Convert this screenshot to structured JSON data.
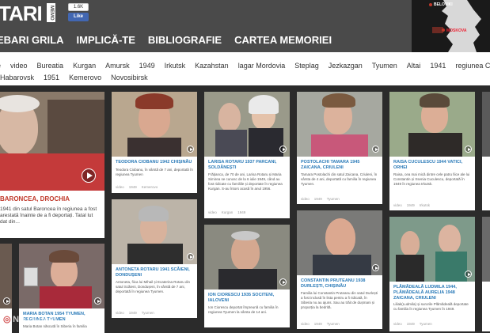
{
  "header": {
    "logo_text": "TARI",
    "logo_box": "MEMO",
    "fb_count": "1.6K",
    "fb_like": "Like",
    "nav": [
      "EBARI GRILA",
      "IMPLICĂ-TE",
      "BIBLIOGRAFIE",
      "CARTEA MEMORIEI"
    ]
  },
  "map": {
    "label_top": "BELOVIKI",
    "label_mid": "MOSKOVA"
  },
  "tags": {
    "row1": [
      "e",
      "video",
      "Bureatia",
      "Kurgan",
      "Amursk",
      "1949",
      "Irkutsk",
      "Kazahstan",
      "lagar Mordovia",
      "Steplag",
      "Jezkazgan",
      "Tyumen",
      "Altai",
      "1941",
      "regiunea Ci"
    ],
    "row2": [
      "Habarovsk",
      "1951",
      "Kemerovo",
      "Novosibirsk"
    ]
  },
  "cards": {
    "big": {
      "title": "BARONCEA, DROCHIA",
      "desc": "1941 din satul Baroncea în regiunea a fost arestată înainte de a fi deportați. Tatal lut dat din..."
    },
    "c1": {
      "title": "TEODORA CIOBANU 1942 CHIȘINĂU",
      "desc": "Teodora Ciobanu, în vârstă de 7 ani, deportată în regiunea Tyumen",
      "tags": [
        "video",
        "1949",
        "Kemerovo"
      ]
    },
    "c2": {
      "title": "LARISA ROTARU 1937 PARCANI, SOLDĂNEȘTI",
      "desc": "Frățianca, de 70 de ani, Larisa Rotaru și Maria Simirea se cunosc de la 6 iulie 1949, când au fost ridicate cu familiile și deportate în regiunea Kurgan. S-au întors acasă în anul 1956.",
      "tags": [
        "video",
        "Kurgan",
        "1949"
      ]
    },
    "c3": {
      "title": "POSTOLACHI TAMARA 1945 ZAICANA, CRIULENI",
      "desc": "Tamara Postolachi din satul Zaicana, Criuleni, în vârsta de 4 ani, deportată cu familia în regiunea Tyumen.",
      "tags": [
        "video",
        "1949",
        "Tyumen"
      ]
    },
    "c4": {
      "title": "RAISA CUCULESCU 1944 VATICI, ORHEI",
      "desc": "Raisa, cea mai mică dintre cele patru fiice ale lui Constantin și Xsenia Cuculescu, deportată în 1949 în regiunea Irkutsk.",
      "tags": [
        "video",
        "1949",
        "Irkutsk"
      ]
    },
    "c5": {
      "title": "ANTONETA ROTARU 1941 SCĂIENI, DONDUȘENI",
      "desc": "Antoneta, fiica lui Mihail și Ecaterina Rotaru din satul Scăieni, Dondușeni, în vârstă de 7 ani, deportată în regiunea Tyumen.",
      "tags": [
        "video",
        "1949",
        "Tyumen"
      ]
    },
    "c6": {
      "title": "ION CIORESCU 1935 SOCITENI, IALOVENI",
      "desc": "Ion Ciorescu deportat împreună cu familia în regiunea Tyumen la vârsta de 14 ani.",
      "tags": [
        "video",
        "1949",
        "Tyumen"
      ]
    },
    "c7": {
      "title": "CONSTANTIN PRUTEANU 1938 DURLEȘTI, CHIȘINĂU",
      "desc": "Familia lui Constantin Pruteanu din satul Durlești a fost inclusă în lista pentru a fi ridicată, în Siberia nu au ajuns. Sau au trăit de dușmani și proporția la bedrită.",
      "tags": [
        "video",
        "1949",
        "Tyumen"
      ]
    },
    "c8": {
      "title": "PLĂMĂDEALĂ LUDMILA 1944, PLĂMĂDEALĂ AURELIA 1948 ZAICANA, CRIULENI",
      "desc": "Liliak(Ludmila) și surorile Plămădeală deportate cu familia în regiunea Tyumen în 1949.",
      "tags": [
        "video",
        "1949",
        "Tyumen"
      ]
    },
    "c9": {
      "title": "MARIA BOTAN 1954 TYUMEN, REGIUNEA TYUMEN",
      "desc": "Maria Botan născută în Siberia în familia"
    }
  },
  "watermark": {
    "mark": "◎",
    "text": "NATIONAL"
  },
  "colors": {
    "header_bg": "#4a4a4a",
    "link_blue": "#2a7ab8",
    "red_title": "#c0392b"
  }
}
